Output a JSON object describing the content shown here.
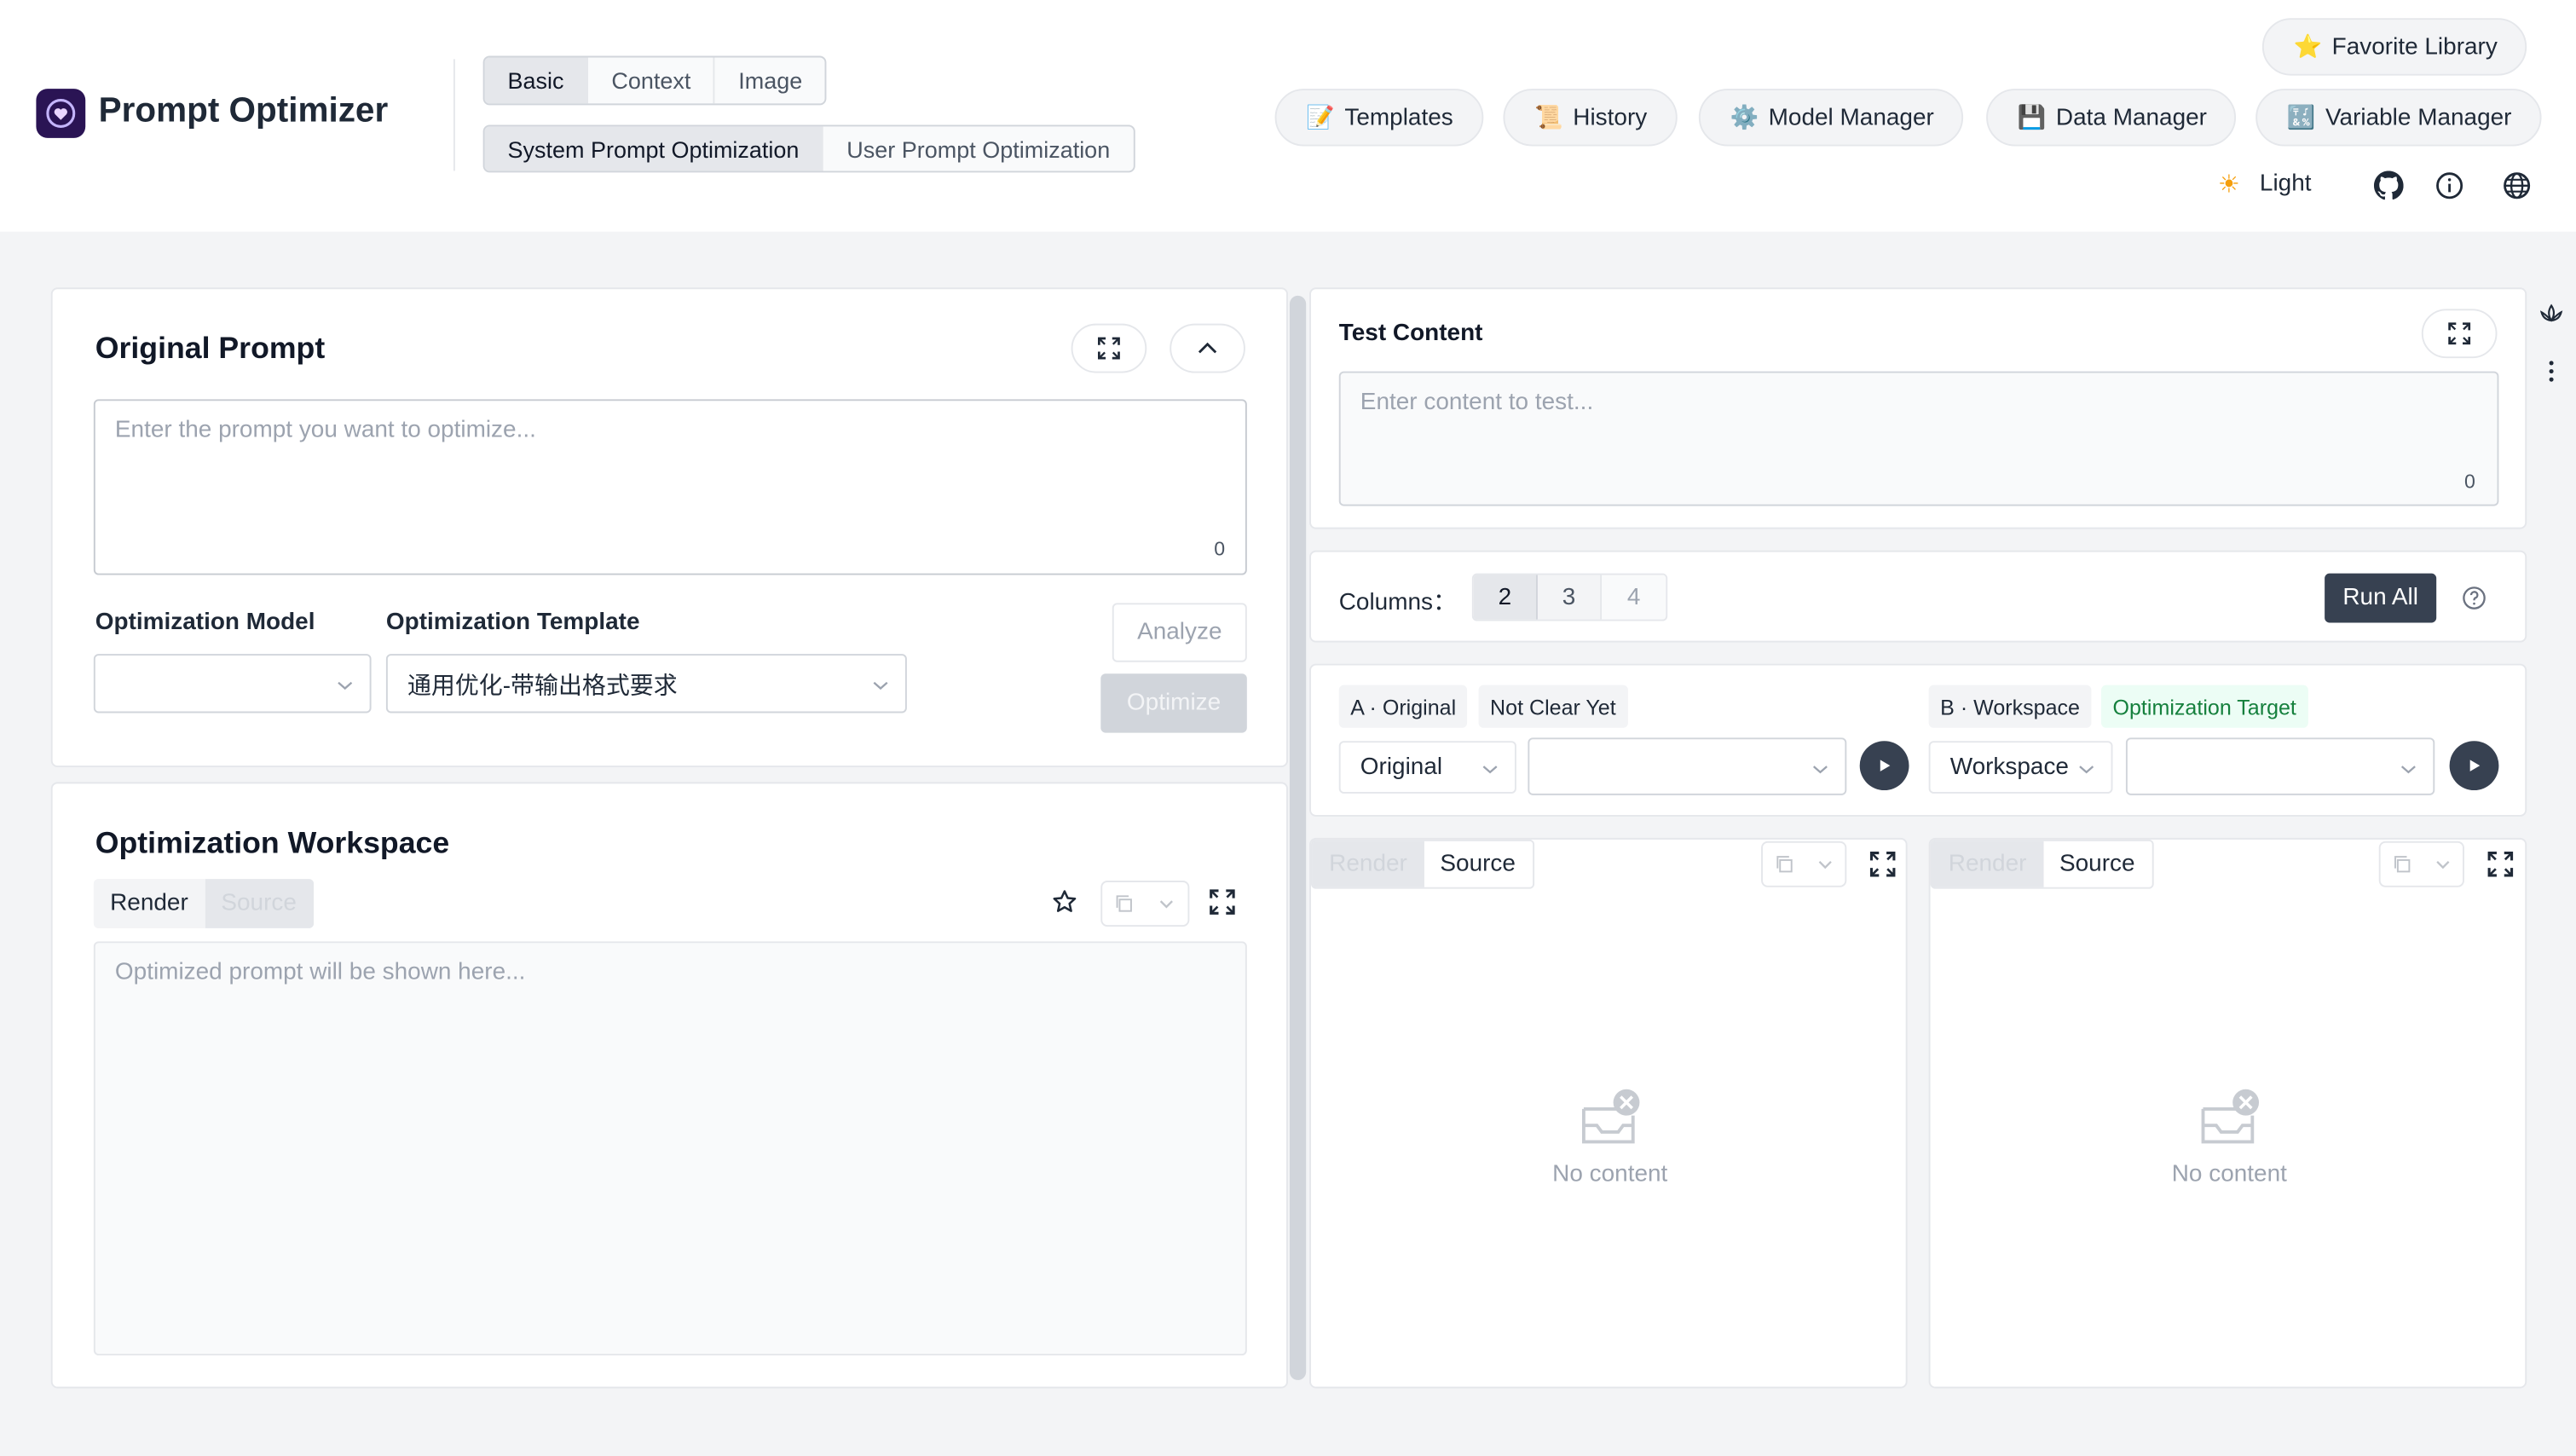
{
  "app": {
    "title": "Prompt Optimizer"
  },
  "mode_tabs": [
    "Basic",
    "Context",
    "Image"
  ],
  "sub_tabs": [
    "System Prompt Optimization",
    "User Prompt Optimization"
  ],
  "header_buttons": {
    "favorite": {
      "emoji": "⭐",
      "label": "Favorite Library"
    },
    "templates": {
      "emoji": "📝",
      "label": "Templates"
    },
    "history": {
      "emoji": "📜",
      "label": "History"
    },
    "model_manager": {
      "emoji": "⚙️",
      "label": "Model Manager"
    },
    "data_manager": {
      "emoji": "💾",
      "label": "Data Manager"
    },
    "variable_manager": {
      "emoji": "🔣",
      "label": "Variable Manager"
    }
  },
  "theme": {
    "icon": "☀",
    "label": "Light"
  },
  "original_prompt": {
    "title": "Original Prompt",
    "placeholder": "Enter the prompt you want to optimize...",
    "count": "0",
    "model_label": "Optimization Model",
    "model_value": "",
    "template_label": "Optimization Template",
    "template_value": "通用优化-带输出格式要求",
    "analyze_label": "Analyze",
    "optimize_label": "Optimize"
  },
  "workspace": {
    "title": "Optimization Workspace",
    "render_label": "Render",
    "source_label": "Source",
    "placeholder": "Optimized prompt will be shown here..."
  },
  "test_content": {
    "title": "Test Content",
    "placeholder": "Enter content to test...",
    "count": "0"
  },
  "columns": {
    "label": "Columns：",
    "options": [
      "2",
      "3",
      "4"
    ],
    "run_all_label": "Run All"
  },
  "col_a": {
    "tag": "A · Original",
    "status": "Not Clear Yet",
    "source_value": "Original",
    "model_value": "",
    "render_label": "Render",
    "source_label": "Source",
    "empty_text": "No content"
  },
  "col_b": {
    "tag": "B · Workspace",
    "status": "Optimization Target",
    "source_value": "Workspace",
    "model_value": "",
    "render_label": "Render",
    "source_label": "Source",
    "empty_text": "No content"
  },
  "colors": {
    "accent_dark": "#374151",
    "green": "#15803d",
    "logo_bg": "#2a1454"
  }
}
